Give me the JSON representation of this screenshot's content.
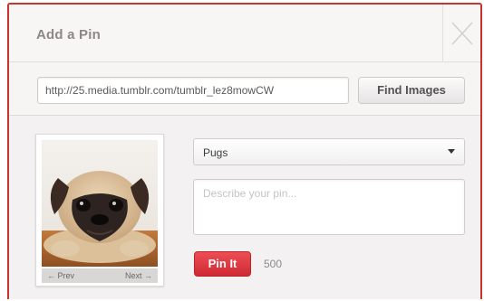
{
  "dialog": {
    "title": "Add a Pin",
    "close_icon": "close-icon"
  },
  "url_row": {
    "url_value": "http://25.media.tumblr.com/tumblr_lez8mowCW",
    "find_button_label": "Find Images"
  },
  "preview": {
    "image": "pug-photo",
    "prev_label": "← Prev",
    "next_label": "Next →"
  },
  "form": {
    "board_selected": "Pugs",
    "board_caret_icon": "caret-down-icon",
    "description_value": "",
    "description_placeholder": "Describe your pin...",
    "pin_button_label": "Pin It",
    "char_count": "500"
  },
  "colors": {
    "accent_red": "#cf2a33",
    "border_red": "#c8332e"
  }
}
